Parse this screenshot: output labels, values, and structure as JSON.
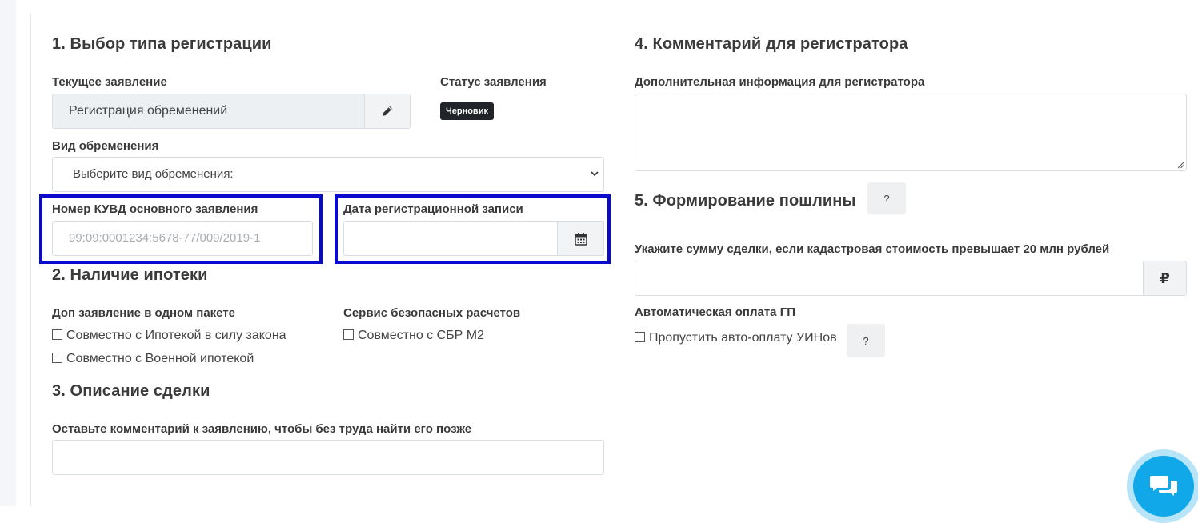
{
  "section1": {
    "title": "1. Выбор типа регистрации",
    "current_label": "Текущее заявление",
    "current_value": "Регистрация обременений",
    "status_label": "Статус заявления",
    "status_badge": "Черновик",
    "encumbrance_label": "Вид обременения",
    "encumbrance_selected": "Выберите вид обременения:",
    "kuvd_label": "Номер КУВД основного заявления",
    "kuvd_placeholder": "99:09:0001234:5678-77/009/2019-1",
    "date_label": "Дата регистрационной записи",
    "date_value": ""
  },
  "section2": {
    "title": "2. Наличие ипотеки",
    "extra_label": "Доп заявление в одном пакете",
    "extra_options": [
      "Совместно с Ипотекой в силу закона",
      "Совместно с Военной ипотекой"
    ],
    "safe_label": "Сервис безопасных расчетов",
    "safe_option": "Совместно с СБР М2"
  },
  "section3": {
    "title": "3. Описание сделки",
    "comment_label": "Оставьте комментарий к заявлению, чтобы без труда найти его позже",
    "comment_value": ""
  },
  "section4": {
    "title": "4. Комментарий для регистратора",
    "info_label": "Дополнительная информация для регистратора",
    "info_value": ""
  },
  "section5": {
    "title": "5. Формирование пошлины",
    "help": "?",
    "amount_label": "Укажите сумму сделки, если кадастровая стоимость превышает 20 млн рублей",
    "amount_value": "",
    "currency": "₽",
    "auto_label": "Автоматическая оплата ГП",
    "auto_option": "Пропустить авто-оплату УИНов",
    "auto_help": "?"
  },
  "colors": {
    "highlight": "#0a0acd",
    "chat": "#11a8ea",
    "badge": "#212529"
  }
}
